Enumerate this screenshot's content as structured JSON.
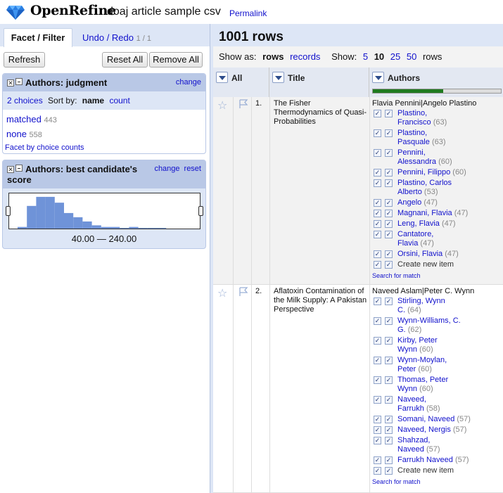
{
  "header": {
    "logo_text": "OpenRefine",
    "project_name": "doaj article sample csv",
    "permalink": "Permalink"
  },
  "left": {
    "tab_facet": "Facet / Filter",
    "tab_undo": "Undo / Redo",
    "tab_undo_count": "1 / 1",
    "refresh": "Refresh",
    "reset_all": "Reset All",
    "remove_all": "Remove All",
    "facet1": {
      "title": "Authors: judgment",
      "change": "change",
      "choices": "2 choices",
      "sort_by": "Sort by:",
      "sort_name": "name",
      "sort_count": "count",
      "items": [
        {
          "label": "matched",
          "count": "443"
        },
        {
          "label": "none",
          "count": "558"
        }
      ],
      "facet_by_counts": "Facet by choice counts"
    },
    "facet2": {
      "title": "Authors: best candidate's score",
      "change": "change",
      "reset": "reset",
      "range": "40.00 — 240.00",
      "histogram": [
        0.05,
        0.7,
        0.98,
        0.98,
        0.8,
        0.48,
        0.35,
        0.22,
        0.1,
        0.05,
        0.05,
        0.02,
        0.05,
        0.02,
        0.01,
        0.01
      ]
    }
  },
  "right": {
    "row_count": "1001 rows",
    "show_as": "Show as:",
    "rows": "rows",
    "records": "records",
    "show": "Show:",
    "page_sizes": [
      "5",
      "10",
      "25",
      "50"
    ],
    "rows_suffix": "rows",
    "col_all": "All",
    "col_title": "Title",
    "col_authors": "Authors",
    "recon_progress": 0.55,
    "search_for_match": "Search for match",
    "create_new": "Create new item"
  },
  "records": [
    {
      "num": "1.",
      "title": "The Fisher Thermodynamics of Quasi-Probabilities",
      "authors": "Flavia Pennini|Angelo Plastino",
      "candidates": [
        {
          "name": "Plastino, Francisco",
          "score": "(63)",
          "lines": [
            "Plastino,",
            "Francisco"
          ]
        },
        {
          "name": "Plastino, Pasquale",
          "score": "(63)",
          "lines": [
            "Plastino,",
            "Pasquale"
          ]
        },
        {
          "name": "Pennini, Alessandra",
          "score": "(60)",
          "lines": [
            "Pennini,",
            "Alessandra"
          ]
        },
        {
          "name": "Pennini, Filippo",
          "score": "(60)",
          "lines": [
            "Pennini, Filippo"
          ]
        },
        {
          "name": "Plastino, Carlos Alberto",
          "score": "(53)",
          "lines": [
            "Plastino, Carlos",
            "Alberto"
          ]
        },
        {
          "name": "Angelo",
          "score": "(47)",
          "lines": [
            "Angelo"
          ]
        },
        {
          "name": "Magnani, Flavia",
          "score": "(47)",
          "lines": [
            "Magnani, Flavia"
          ]
        },
        {
          "name": "Leng, Flavia",
          "score": "(47)",
          "lines": [
            "Leng, Flavia"
          ]
        },
        {
          "name": "Cantatore, Flavia",
          "score": "(47)",
          "lines": [
            "Cantatore,",
            "Flavia"
          ]
        },
        {
          "name": "Orsini, Flavia",
          "score": "(47)",
          "lines": [
            "Orsini, Flavia"
          ]
        }
      ]
    },
    {
      "num": "2.",
      "title": "Aflatoxin Contamination of the Milk Supply: A Pakistan Perspective",
      "authors": "Naveed Aslam|Peter C. Wynn",
      "candidates": [
        {
          "name": "Stirling, Wynn C.",
          "score": "(64)",
          "lines": [
            "Stirling, Wynn",
            "C."
          ]
        },
        {
          "name": "Wynn-Williams, C. G.",
          "score": "(62)",
          "lines": [
            "Wynn-Williams, C.",
            "G."
          ]
        },
        {
          "name": "Kirby, Peter Wynn",
          "score": "(60)",
          "lines": [
            "Kirby, Peter",
            "Wynn"
          ]
        },
        {
          "name": "Wynn-Moylan, Peter",
          "score": "(60)",
          "lines": [
            "Wynn-Moylan,",
            "Peter"
          ]
        },
        {
          "name": "Thomas, Peter Wynn",
          "score": "(60)",
          "lines": [
            "Thomas, Peter",
            "Wynn"
          ]
        },
        {
          "name": "Naveed, Farrukh",
          "score": "(58)",
          "lines": [
            "Naveed,",
            "Farrukh"
          ]
        },
        {
          "name": "Somani, Naveed",
          "score": "(57)",
          "lines": [
            "Somani, Naveed"
          ]
        },
        {
          "name": "Naveed, Nergis",
          "score": "(57)",
          "lines": [
            "Naveed, Nergis"
          ]
        },
        {
          "name": "Shahzad, Naveed",
          "score": "(57)",
          "lines": [
            "Shahzad,",
            "Naveed"
          ]
        },
        {
          "name": "Farrukh Naveed",
          "score": "(57)",
          "lines": [
            "Farrukh Naveed"
          ]
        }
      ]
    }
  ]
}
